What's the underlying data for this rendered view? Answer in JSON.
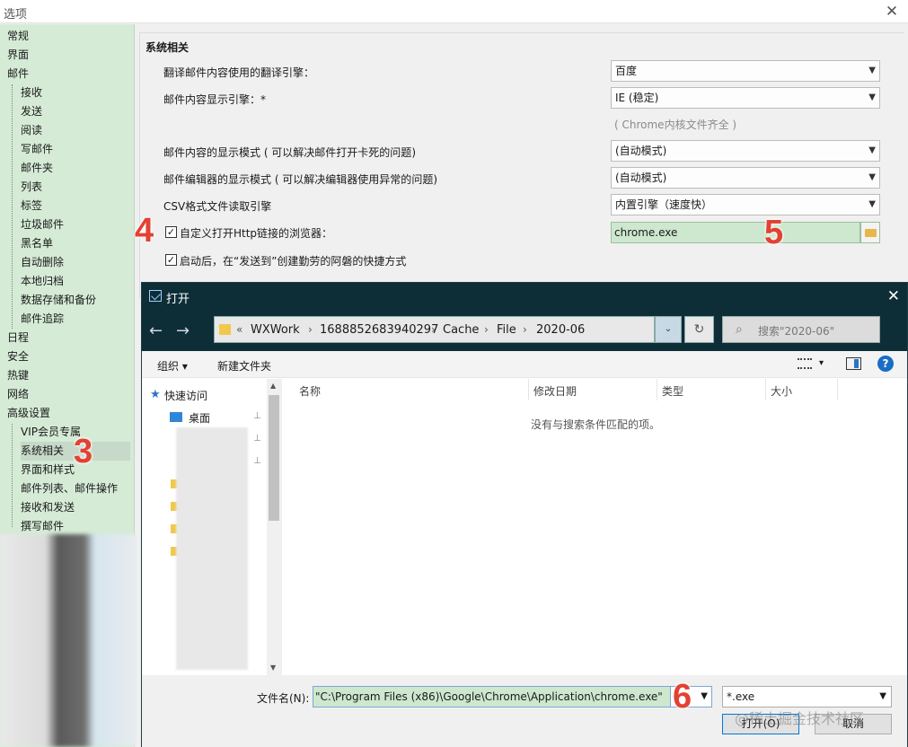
{
  "window": {
    "title": "选项",
    "close": "✕"
  },
  "nav": {
    "items": [
      {
        "label": "常规"
      },
      {
        "label": "界面"
      },
      {
        "label": "邮件"
      },
      {
        "label": "接收"
      },
      {
        "label": "发送"
      },
      {
        "label": "阅读"
      },
      {
        "label": "写邮件"
      },
      {
        "label": "邮件夹"
      },
      {
        "label": "列表"
      },
      {
        "label": "标签"
      },
      {
        "label": "垃圾邮件"
      },
      {
        "label": "黑名单"
      },
      {
        "label": "自动删除"
      },
      {
        "label": "本地归档"
      },
      {
        "label": "数据存储和备份"
      },
      {
        "label": "邮件追踪"
      },
      {
        "label": "日程"
      },
      {
        "label": "安全"
      },
      {
        "label": "热键"
      },
      {
        "label": "网络"
      },
      {
        "label": "高级设置"
      },
      {
        "label": "VIP会员专属"
      },
      {
        "label": "系统相关"
      },
      {
        "label": "界面和样式"
      },
      {
        "label": "邮件列表、邮件操作"
      },
      {
        "label": "接收和发送"
      },
      {
        "label": "撰写邮件"
      }
    ]
  },
  "settings": {
    "group_title": "系统相关",
    "translate_label": "翻译邮件内容使用的翻译引擎：",
    "translate_value": "百度",
    "render_label": "邮件内容显示引擎：*",
    "render_value": "IE (稳定)",
    "render_hint": "( Chrome内核文件齐全 )",
    "display_mode_label": "邮件内容的显示模式 ( 可以解决邮件打开卡死的问题)",
    "display_mode_value": "(自动模式)",
    "editor_mode_label": "邮件编辑器的显示模式 ( 可以解决编辑器使用异常的问题)",
    "editor_mode_value": "(自动模式)",
    "csv_label": "CSV格式文件读取引擎",
    "csv_value": "内置引擎（速度快）",
    "custom_browser_label": "自定义打开Http链接的浏览器：",
    "custom_browser_value": "chrome.exe",
    "sendto_label": "启动后，在“发送到”创建勤劳的阿磐的快捷方式",
    "check_mark": "✓"
  },
  "badges": {
    "b3": "3",
    "b4": "4",
    "b5": "5",
    "b6": "6"
  },
  "dialog": {
    "title": "打开",
    "close": "✕",
    "back": "←",
    "forward": "→",
    "path": [
      "«",
      "WXWork",
      "1688852683940297",
      "Cache",
      "File",
      "2020-06"
    ],
    "path_sep": "›",
    "addr_drop": "⌄",
    "refresh": "↻",
    "search_placeholder": "搜索\"2020-06\"",
    "search_icon": "⌕",
    "organize": "组织 ▾",
    "new_folder": "新建文件夹",
    "view_arrow": "▾",
    "help": "?",
    "quick_access": "快速访问",
    "desktop": "桌面",
    "pin": "📌",
    "columns": [
      "名称",
      "修改日期",
      "类型",
      "大小"
    ],
    "empty_text": "没有与搜索条件匹配的项。",
    "filename_label": "文件名(N):",
    "filename_value": "\"C:\\Program Files (x86)\\Google\\Chrome\\Application\\chrome.exe\"",
    "filetype_value": "*.exe",
    "open_button": "打开(O)",
    "cancel_button": "取消"
  },
  "watermark": "@稀土掘金技术社区",
  "icons": [
    "close-icon",
    "folder-icon",
    "check-icon",
    "back-arrow-icon",
    "forward-arrow-icon",
    "refresh-icon",
    "search-icon",
    "star-icon",
    "desktop-icon",
    "pin-icon",
    "help-icon",
    "pane-icon",
    "view-icon",
    "chevron-down-icon"
  ],
  "colors": {
    "nav_bg": "#d5ebd6",
    "dialog_title_bg": "#0d2d37",
    "badge": "#e34132",
    "highlight_input": "#cde8cf"
  }
}
